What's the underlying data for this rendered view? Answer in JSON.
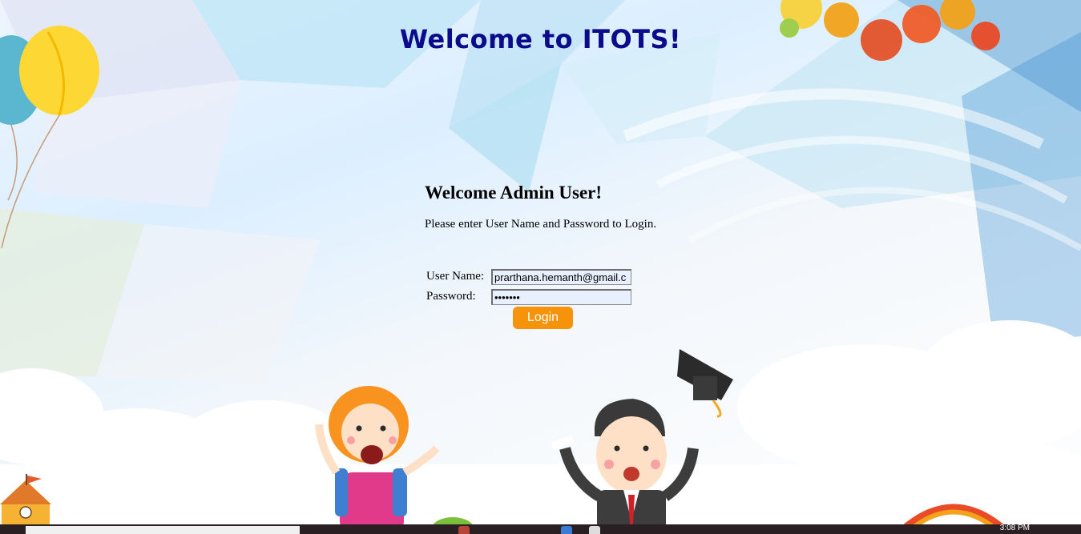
{
  "page": {
    "heading": "Welcome to ITOTS!",
    "welcome_title": "Welcome Admin User!",
    "instructions": "Please enter User Name and Password to Login."
  },
  "form": {
    "username_label": "User Name:",
    "username_value": "prarthana.hemanth@gmail.c",
    "password_label": "Password:",
    "password_value": "•••••••",
    "login_label": "Login"
  },
  "taskbar": {
    "clock": "3:08 PM"
  },
  "colors": {
    "heading": "#0b0b8c",
    "login_button": "#f7930a"
  }
}
